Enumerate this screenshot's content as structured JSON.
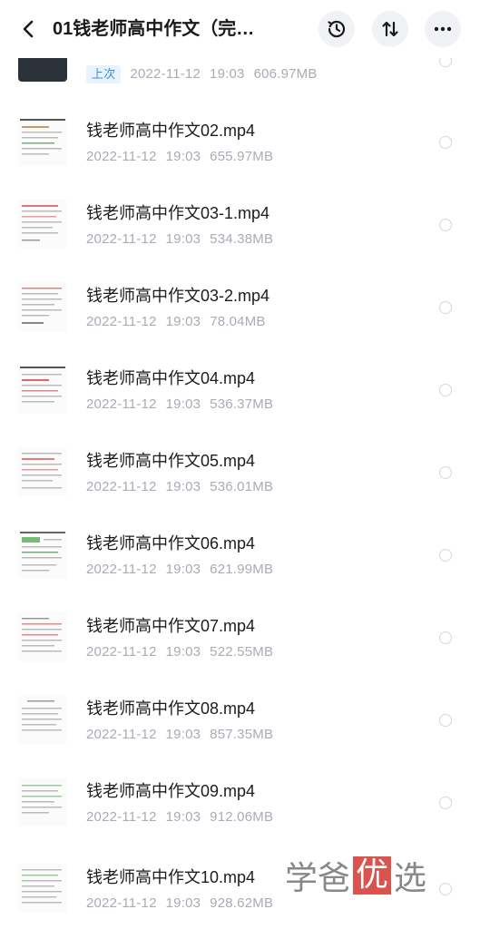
{
  "header": {
    "title": "01钱老师高中作文（完…",
    "back_icon": "chevron-left-icon",
    "history_icon": "clock-history-icon",
    "sort_icon": "sort-icon",
    "more_icon": "more-icon"
  },
  "partial_item": {
    "badge": "上次",
    "date": "2022-11-12",
    "time": "19:03",
    "size": "606.97MB"
  },
  "files": [
    {
      "name": "钱老师高中作文02.mp4",
      "date": "2022-11-12",
      "time": "19:03",
      "size": "655.97MB"
    },
    {
      "name": "钱老师高中作文03-1.mp4",
      "date": "2022-11-12",
      "time": "19:03",
      "size": "534.38MB"
    },
    {
      "name": "钱老师高中作文03-2.mp4",
      "date": "2022-11-12",
      "time": "19:03",
      "size": "78.04MB"
    },
    {
      "name": "钱老师高中作文04.mp4",
      "date": "2022-11-12",
      "time": "19:03",
      "size": "536.37MB"
    },
    {
      "name": "钱老师高中作文05.mp4",
      "date": "2022-11-12",
      "time": "19:03",
      "size": "536.01MB"
    },
    {
      "name": "钱老师高中作文06.mp4",
      "date": "2022-11-12",
      "time": "19:03",
      "size": "621.99MB"
    },
    {
      "name": "钱老师高中作文07.mp4",
      "date": "2022-11-12",
      "time": "19:03",
      "size": "522.55MB"
    },
    {
      "name": "钱老师高中作文08.mp4",
      "date": "2022-11-12",
      "time": "19:03",
      "size": "857.35MB"
    },
    {
      "name": "钱老师高中作文09.mp4",
      "date": "2022-11-12",
      "time": "19:03",
      "size": "912.06MB"
    },
    {
      "name": "钱老师高中作文10.mp4",
      "date": "2022-11-12",
      "time": "19:03",
      "size": "928.62MB"
    }
  ],
  "watermark": {
    "part1": "学爸",
    "part2": "优",
    "part3": "选"
  },
  "colors": {
    "accent": "#3a8ee6",
    "meta_text": "#a7acb6",
    "watermark_red": "#d9534f"
  }
}
